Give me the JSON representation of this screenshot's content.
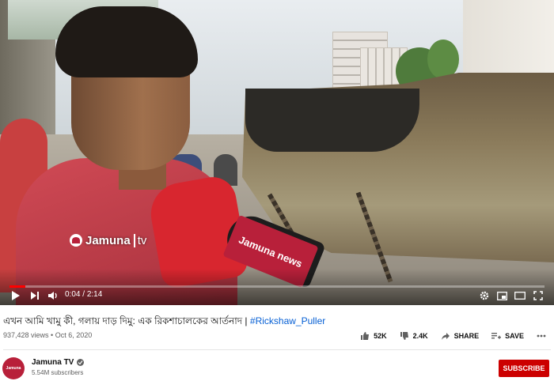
{
  "player": {
    "watermark_brand": "Jamuna",
    "watermark_suffix": "tv",
    "mic_flag_text": "Jamuna news",
    "time_current": "0:04",
    "time_separator": " / ",
    "time_total": "2:14",
    "progress_fraction": 0.03
  },
  "video": {
    "title_main": "এখন আমি খামু কী, গলায় দাড় দিমু: এক রিকশাচালকের আর্তনাদ | ",
    "title_hashtag": "#Rickshaw_Puller",
    "views": "937,428 views",
    "meta_separator": " • ",
    "date": "Oct 6, 2020"
  },
  "actions": {
    "likes": "52K",
    "dislikes": "2.4K",
    "share_label": "SHARE",
    "save_label": "SAVE"
  },
  "channel": {
    "name": "Jamuna TV",
    "subscribers": "5.54M subscribers",
    "avatar_text": "Jamuna",
    "subscribe_label": "SUBSCRIBE"
  },
  "colors": {
    "progress": "#ff0000",
    "subscribe": "#cc0000",
    "hashtag": "#065fd4",
    "brand": "#b8203a"
  }
}
